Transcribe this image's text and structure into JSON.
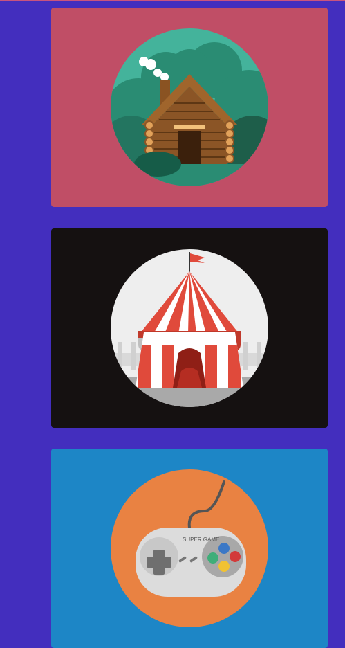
{
  "colors": {
    "page_background": "#432ebe",
    "top_accent": "#c9547e"
  },
  "cards": [
    {
      "illustration": "log-cabin-icon",
      "background": "#c04e66"
    },
    {
      "illustration": "circus-tent-icon",
      "background": "#151111"
    },
    {
      "illustration": "game-controller-icon",
      "background": "#1d86c6",
      "controller_label": "SUPER GAME"
    }
  ]
}
